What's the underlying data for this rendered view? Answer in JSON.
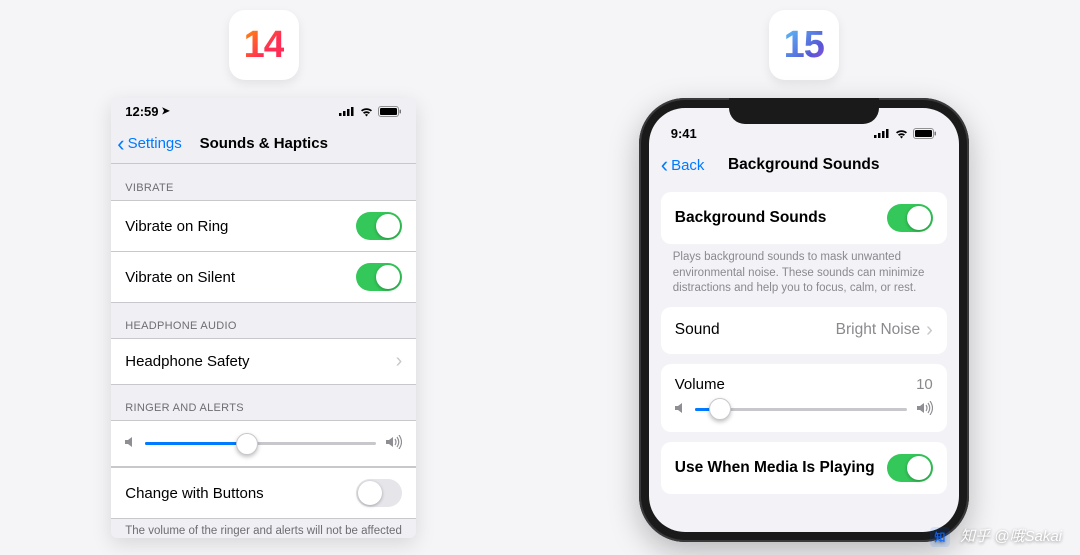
{
  "badges": {
    "ios14": "14",
    "ios15": "15"
  },
  "ios14": {
    "statusbar": {
      "time": "12:59"
    },
    "nav": {
      "back": "Settings",
      "title": "Sounds & Haptics"
    },
    "sections": {
      "vibrate": {
        "header": "VIBRATE",
        "rows": [
          {
            "label": "Vibrate on Ring",
            "on": true
          },
          {
            "label": "Vibrate on Silent",
            "on": true
          }
        ]
      },
      "headphone": {
        "header": "HEADPHONE AUDIO",
        "rows": [
          {
            "label": "Headphone Safety"
          }
        ]
      },
      "ringer": {
        "header": "RINGER AND ALERTS",
        "slider_percent": 44,
        "change_label": "Change with Buttons",
        "change_on": false,
        "footer": "The volume of the ringer and alerts will not be affected by the volume buttons."
      }
    }
  },
  "ios15": {
    "statusbar": {
      "time": "9:41"
    },
    "nav": {
      "back": "Back",
      "title": "Background Sounds"
    },
    "bg_sounds": {
      "label": "Background Sounds",
      "on": true,
      "note": "Plays background sounds to mask unwanted environmental noise. These sounds can minimize distractions and help you to focus, calm, or rest."
    },
    "sound_row": {
      "label": "Sound",
      "value": "Bright Noise"
    },
    "volume": {
      "label": "Volume",
      "value": "10",
      "percent": 12
    },
    "media_row": {
      "label": "Use When Media Is Playing",
      "on": true
    }
  },
  "watermark": {
    "logo": "知",
    "text": "知乎 @哦Sakai"
  }
}
